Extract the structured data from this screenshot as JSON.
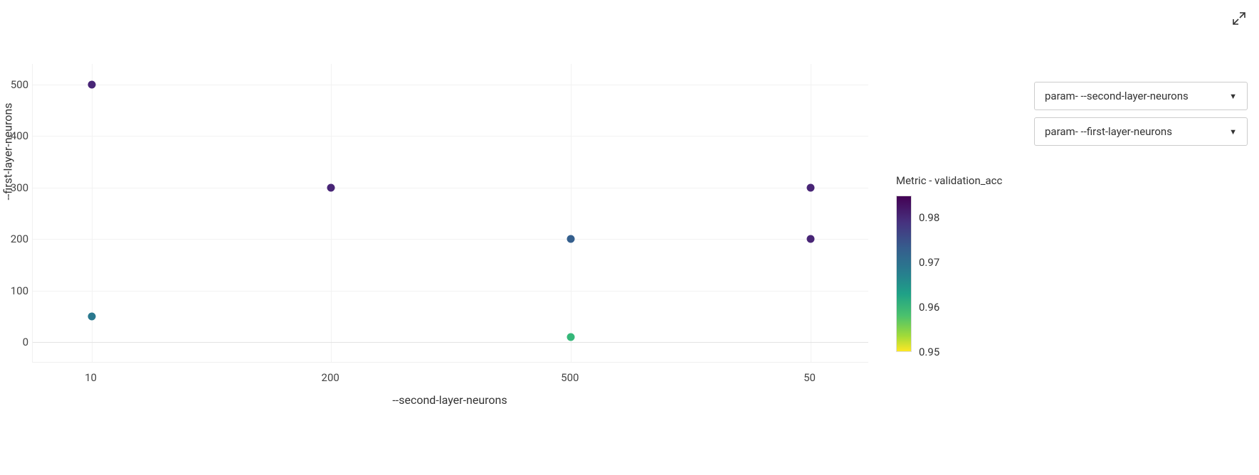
{
  "chart_data": {
    "type": "scatter",
    "xlabel": "--second-layer-neurons",
    "ylabel": "--first-layer-neurons",
    "x_categories": [
      "10",
      "200",
      "500",
      "50"
    ],
    "y_ticks": [
      0,
      100,
      200,
      300,
      400,
      500
    ],
    "ylim": [
      -40,
      540
    ],
    "color_metric": "validation_acc",
    "color_scale": {
      "min": 0.95,
      "max": 0.985
    },
    "colorbar_title": "Metric - validation_acc",
    "colorbar_ticks": [
      0.98,
      0.97,
      0.96,
      0.95
    ],
    "series": [
      {
        "x_cat": "10",
        "y": 500,
        "color_val": 0.982,
        "color": "#482576"
      },
      {
        "x_cat": "10",
        "y": 50,
        "color_val": 0.968,
        "color": "#2a788e"
      },
      {
        "x_cat": "200",
        "y": 300,
        "color_val": 0.981,
        "color": "#482576"
      },
      {
        "x_cat": "500",
        "y": 200,
        "color_val": 0.973,
        "color": "#355f8d"
      },
      {
        "x_cat": "500",
        "y": 10,
        "color_val": 0.96,
        "color": "#35b779"
      },
      {
        "x_cat": "50",
        "y": 300,
        "color_val": 0.981,
        "color": "#482576"
      },
      {
        "x_cat": "50",
        "y": 200,
        "color_val": 0.98,
        "color": "#482576"
      }
    ]
  },
  "dropdown1": {
    "label": "param- --second-layer-neurons"
  },
  "dropdown2": {
    "label": "param- --first-layer-neurons"
  }
}
